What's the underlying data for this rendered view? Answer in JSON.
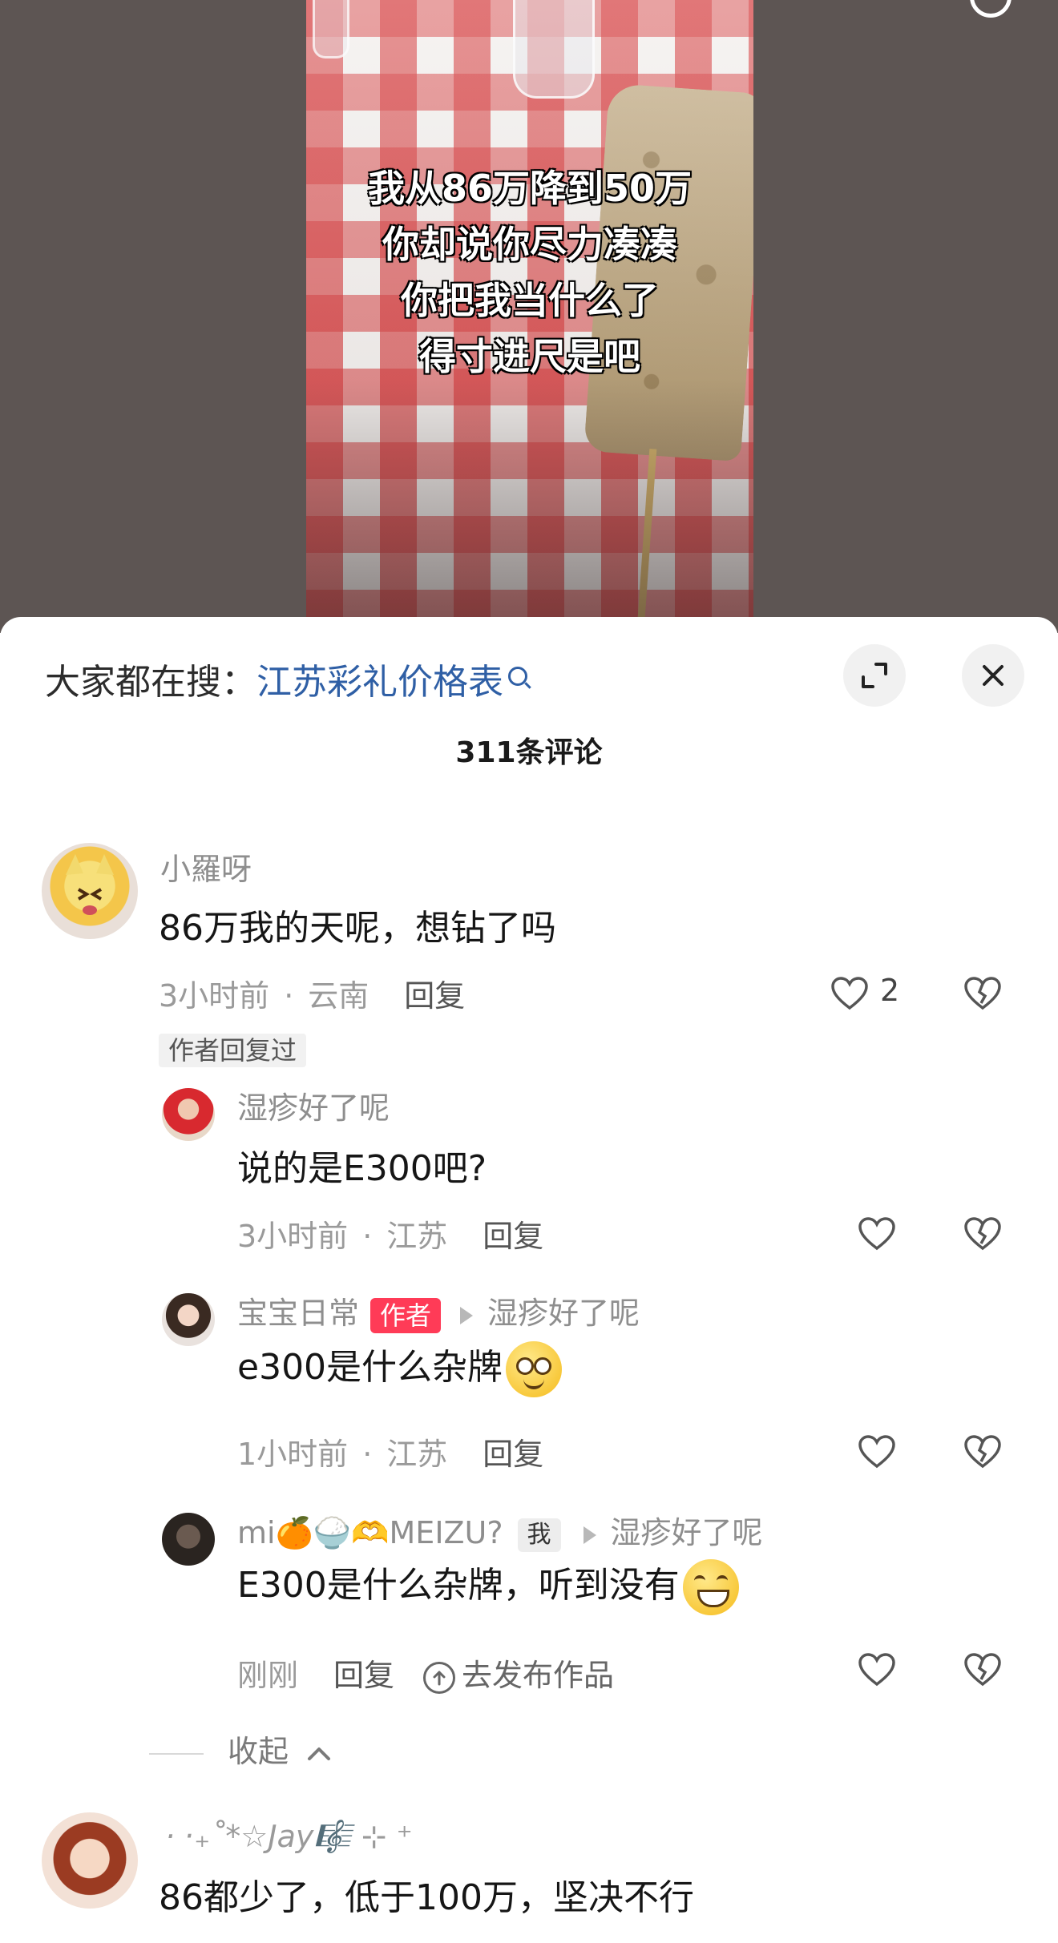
{
  "video": {
    "caption_lines": [
      "我从86万降到50万",
      "你却说你尽力凑凑",
      "你把我当什么了",
      "得寸进尺是吧"
    ]
  },
  "comments_panel": {
    "search_prefix": "大家都在搜：",
    "search_term": "江苏彩礼价格表",
    "count_label": "311条评论",
    "collapse_label": "收起",
    "comments": [
      {
        "username": "小羅呀",
        "text": "86万我的天呢，想钻了吗",
        "time": "3小时前",
        "location": "云南",
        "reply_label": "回复",
        "likes": "2",
        "author_replied_label": "作者回复过"
      },
      {
        "username": "湿疹好了呢",
        "text": "说的是E300吧?",
        "time": "3小时前",
        "location": "江苏",
        "reply_label": "回复"
      },
      {
        "username": "宝宝日常",
        "author_tag": "作者",
        "reply_to": "湿疹好了呢",
        "text": "e300是什么杂牌",
        "time": "1小时前",
        "location": "江苏",
        "reply_label": "回复"
      },
      {
        "username": "mi🍊🍚🫶MEIZU?",
        "me_tag": "我",
        "reply_to": "湿疹好了呢",
        "text": "E300是什么杂牌，听到没有",
        "time": "刚刚",
        "reply_label": "回复",
        "publish_label": "去发布作品"
      },
      {
        "username": "·  ‧₊˚*☆Jay🎼 ⊹ ⁺",
        "text": "86都少了，低于100万，坚决不行"
      }
    ]
  },
  "colors": {
    "link_blue": "#2f5fa5",
    "author_tag_red": "#ff3b57",
    "muted_text": "#9a9a9a"
  }
}
